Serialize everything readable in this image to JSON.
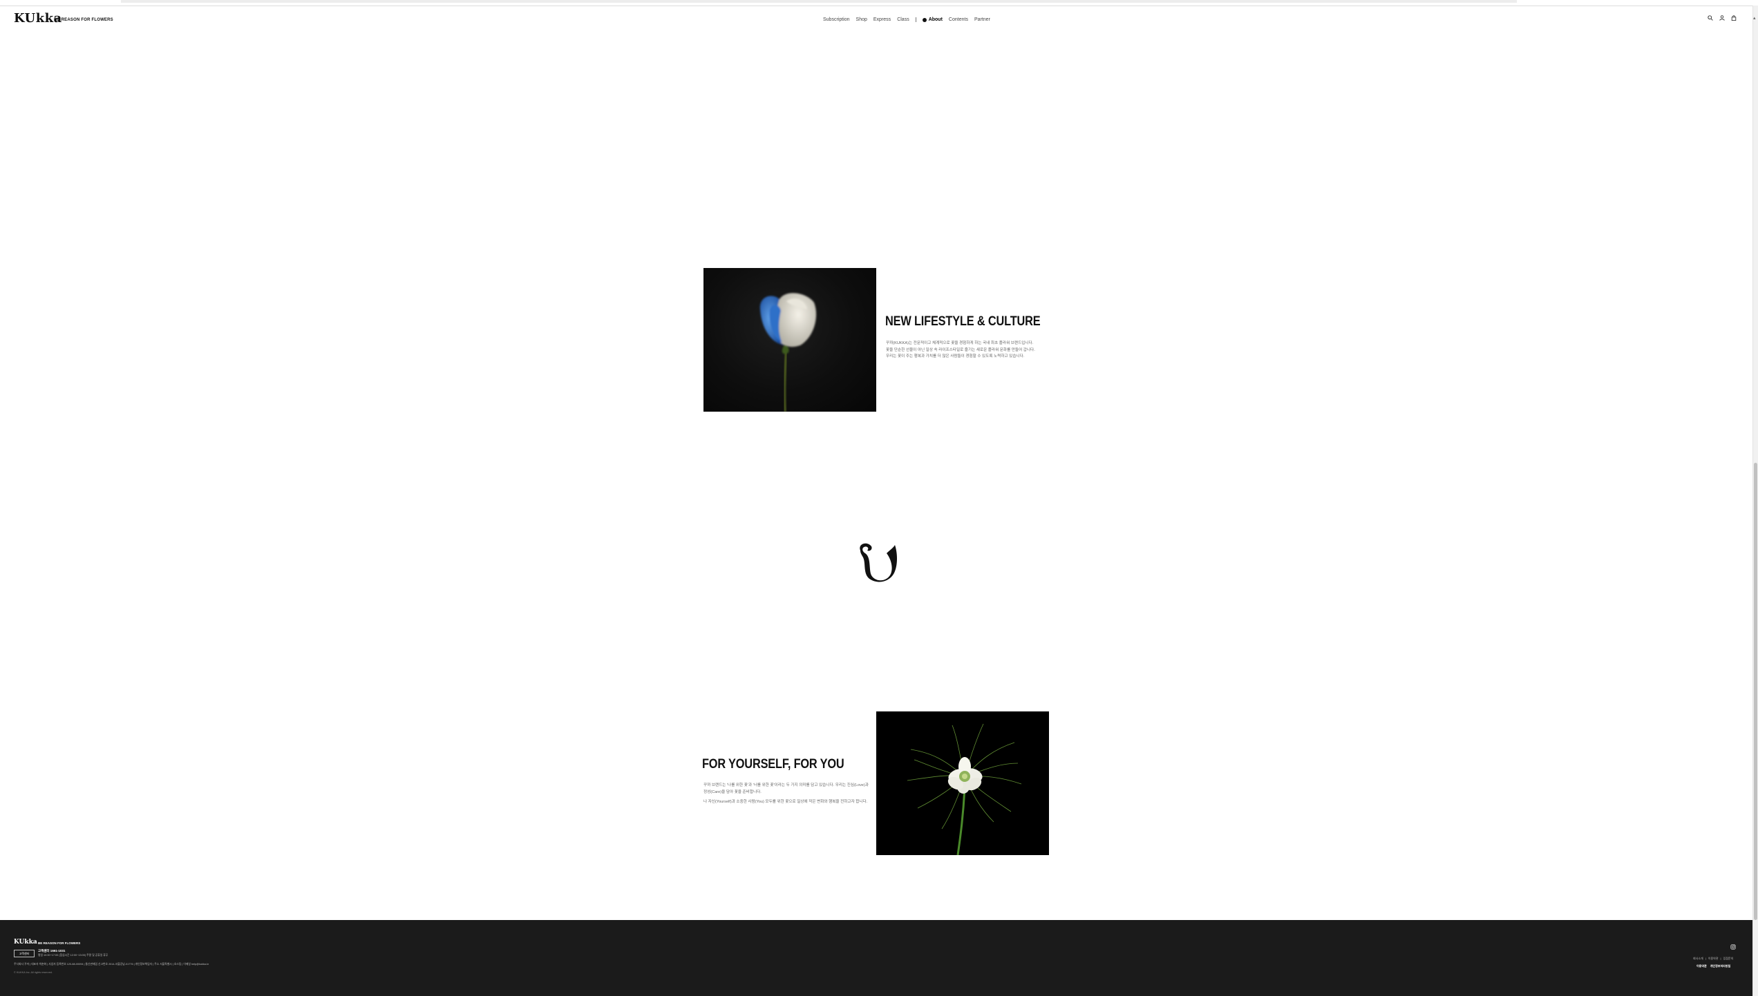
{
  "header": {
    "logo": "KUkka",
    "tagline": "BE REASON FOR FLOWERS",
    "nav": [
      {
        "label": "Subscription"
      },
      {
        "label": "Shop"
      },
      {
        "label": "Express"
      },
      {
        "label": "Class"
      },
      {
        "label": "About",
        "active": true
      },
      {
        "label": "Contents"
      },
      {
        "label": "Partner"
      }
    ],
    "icons": [
      "search-icon",
      "user-icon",
      "cart-icon"
    ]
  },
  "section1": {
    "title": "NEW LIFESTYLE & CULTURE",
    "body": [
      "꾸까(KUKKA)는 전문적이고 체계적으로 꽃을 경험하게 하는 국내 최초 플라워 브랜드입니다.",
      "꽃을 단순한 선물이 아닌 일상 속 라이프스타일로 즐기는 새로운 플라워 문화를 만들어 갑니다.",
      "우리는 꽃이 주는 행복과 가치를 더 많은 사람들이 경험할 수 있도록 노력하고 있습니다."
    ]
  },
  "ornament": {
    "glyph": "U"
  },
  "section2": {
    "title": "FOR YOURSELF, FOR YOU",
    "paragraphs": [
      "꾸까 브랜드는 '나를 위한 꽃'과 '너를 위한 꽃'이라는 두 가지 의미를 담고 있습니다. 우리는 진심(Love)과 정성(Care)을 담아 꽃을 준비합니다.",
      "나 자신(Yourself)과 소중한 사람(You) 모두를 위한 꽃으로 일상에 작은 변화와 행복을 전하고자 합니다."
    ]
  },
  "footer": {
    "logo": "KUkka",
    "tagline": "BE REASON FOR FLOWERS",
    "button": "고객센터",
    "cs_title": "고객센터 1661-1031",
    "cs_detail": "평일 10:00~17:00 (점심시간 12:00~13:00) 주말 및 공휴일 휴무",
    "company": "주식회사 꾸까 | 대표자 박춘화 | 사업자 등록번호 120-88-00094 | 통신판매업 신고번호 2014-서울강남-01776 | 개인정보책임자 | 주소 서울특별시 | 호스팅 | 이메일 help@kukka.kr",
    "copyright": "© KUKKA Inc. All rights reserved.",
    "links_top": [
      "회사소개",
      "이용약관",
      "입점문의"
    ],
    "links_bottom": [
      "이용약관",
      "개인정보처리방침"
    ]
  }
}
